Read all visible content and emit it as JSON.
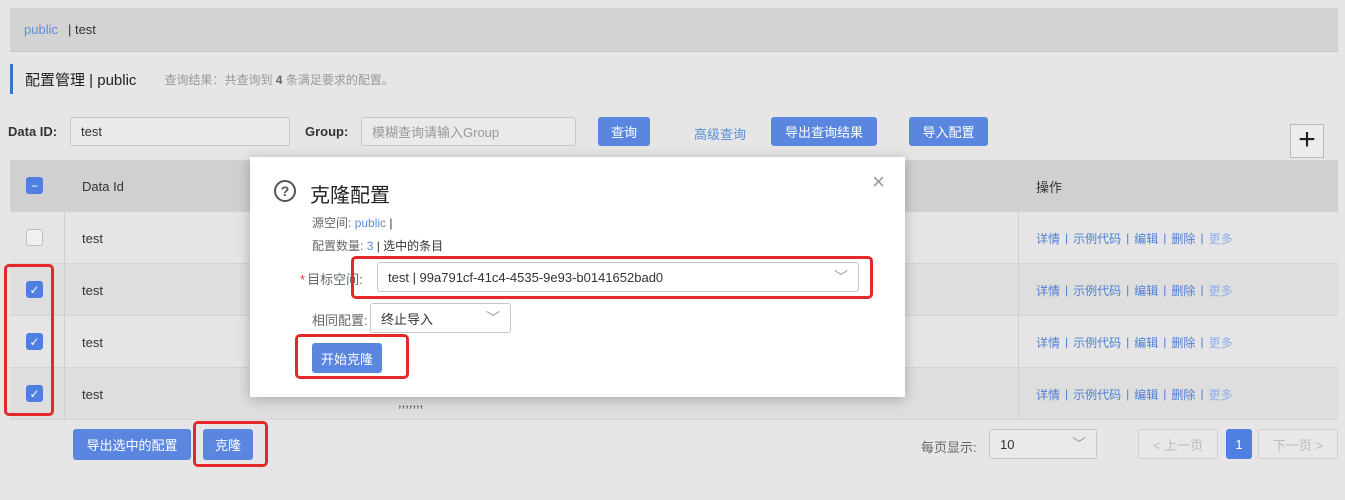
{
  "namespace_bar": {
    "active": "public",
    "other": "| test"
  },
  "header": {
    "title": "配置管理 | public",
    "result_prefix": "查询结果：共查询到",
    "result_count": "4",
    "result_suffix": "条满足要求的配置。"
  },
  "search": {
    "data_id_label": "Data ID:",
    "data_id_value": "test",
    "group_label": "Group:",
    "group_placeholder": "模糊查询请输入Group",
    "query_button": "查询",
    "advanced_link": "高级查询",
    "export_button": "导出查询结果",
    "import_button": "导入配置",
    "add_icon": "+"
  },
  "table": {
    "headers": {
      "data_id": "Data Id",
      "ops": "操作"
    },
    "header_checkbox": "−",
    "rows": [
      {
        "data_id": "test",
        "checked": false,
        "col3": ""
      },
      {
        "data_id": "test",
        "checked": true,
        "col3": ""
      },
      {
        "data_id": "test",
        "checked": true,
        "col3": ""
      },
      {
        "data_id": "test",
        "checked": true,
        "col3": ",,,,,,,"
      }
    ],
    "ops": {
      "detail": "详情",
      "sample": "示例代码",
      "edit": "编辑",
      "delete": "删除",
      "more": "更多",
      "sep": "|"
    }
  },
  "footer": {
    "export_selected": "导出选中的配置",
    "clone": "克隆",
    "page_size_label": "每页显示:",
    "page_size": "10",
    "prev": "< 上一页",
    "current_page": "1",
    "next": "下一页 >"
  },
  "dialog": {
    "title": "克隆配置",
    "close": "×",
    "question_icon": "?",
    "source_label": "源空间:",
    "source_value": "public",
    "source_suffix": "|",
    "count_label": "配置数量:",
    "count_value": "3",
    "count_suffix": "| 选中的条目",
    "required_mark": "*",
    "target_label": "目标空间:",
    "target_value": "test | 99a791cf-41c4-4535-9e93-b0141652bad0",
    "policy_label": "相同配置:",
    "policy_value": "终止导入",
    "start_button": "开始克隆"
  },
  "colors": {
    "primary": "#5a86e0",
    "link": "#5b8fd6",
    "highlight": "#e32a2a"
  },
  "icons": [
    "question-circle-icon",
    "close-icon",
    "chevron-down-icon",
    "plus-icon",
    "check-icon"
  ]
}
